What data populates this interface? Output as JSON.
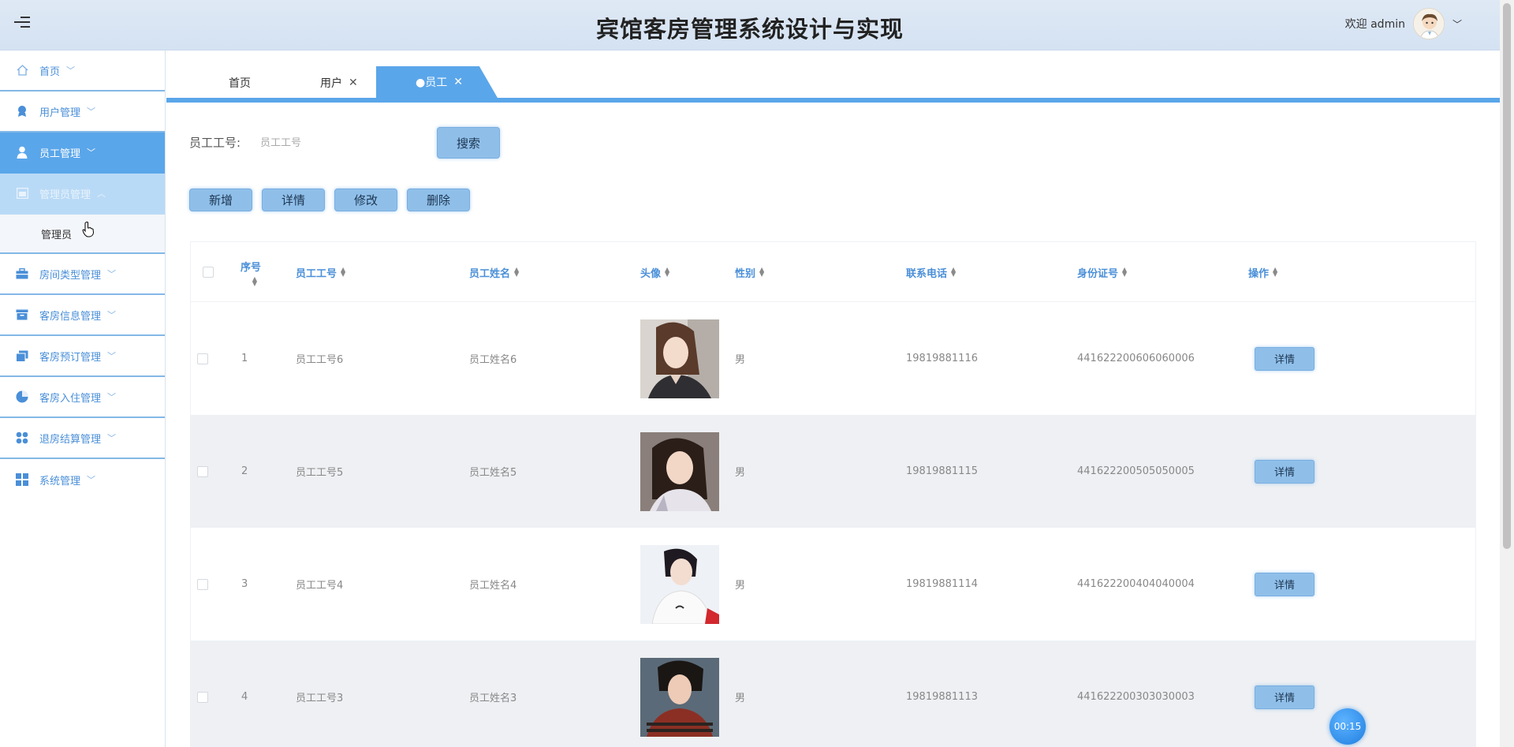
{
  "header": {
    "title": "宾馆客房管理系统设计与实现",
    "welcome": "欢迎 admin"
  },
  "sidebar": {
    "items": [
      {
        "label": "首页",
        "icon": "home-icon"
      },
      {
        "label": "用户管理",
        "icon": "user-badge-icon"
      },
      {
        "label": "员工管理",
        "icon": "person-icon"
      },
      {
        "label": "管理员管理",
        "icon": "admin-icon"
      },
      {
        "label": "房间类型管理",
        "icon": "briefcase-icon"
      },
      {
        "label": "客房信息管理",
        "icon": "archive-icon"
      },
      {
        "label": "客房预订管理",
        "icon": "copy-icon"
      },
      {
        "label": "客房入住管理",
        "icon": "pie-icon"
      },
      {
        "label": "退房结算管理",
        "icon": "apps-icon"
      },
      {
        "label": "系统管理",
        "icon": "grid-icon"
      }
    ],
    "sub_item": "管理员"
  },
  "tabs": [
    {
      "label": "首页"
    },
    {
      "label": "用户"
    },
    {
      "label": "●员工"
    }
  ],
  "search": {
    "label": "员工工号:",
    "placeholder": "员工工号",
    "button": "搜索"
  },
  "toolbar": {
    "add": "新增",
    "detail": "详情",
    "edit": "修改",
    "delete": "删除"
  },
  "table": {
    "columns": [
      "序号",
      "员工工号",
      "员工姓名",
      "头像",
      "性别",
      "联系电话",
      "身份证号",
      "操作"
    ],
    "row_button": "详情",
    "rows": [
      {
        "index": "1",
        "emp_no": "员工工号6",
        "name": "员工姓名6",
        "gender": "男",
        "phone": "19819881116",
        "id_card": "441622200606060006"
      },
      {
        "index": "2",
        "emp_no": "员工工号5",
        "name": "员工姓名5",
        "gender": "男",
        "phone": "19819881115",
        "id_card": "441622200505050005"
      },
      {
        "index": "3",
        "emp_no": "员工工号4",
        "name": "员工姓名4",
        "gender": "男",
        "phone": "19819881114",
        "id_card": "441622200404040004"
      },
      {
        "index": "4",
        "emp_no": "员工工号3",
        "name": "员工姓名3",
        "gender": "男",
        "phone": "19819881113",
        "id_card": "441622200303030003"
      }
    ]
  },
  "timer": "00:15",
  "colors": {
    "accent": "#5aa6ea",
    "header_bg": "#d4e2f2",
    "button_bg": "#8fbfe9",
    "link_text": "#4a8fd8"
  }
}
